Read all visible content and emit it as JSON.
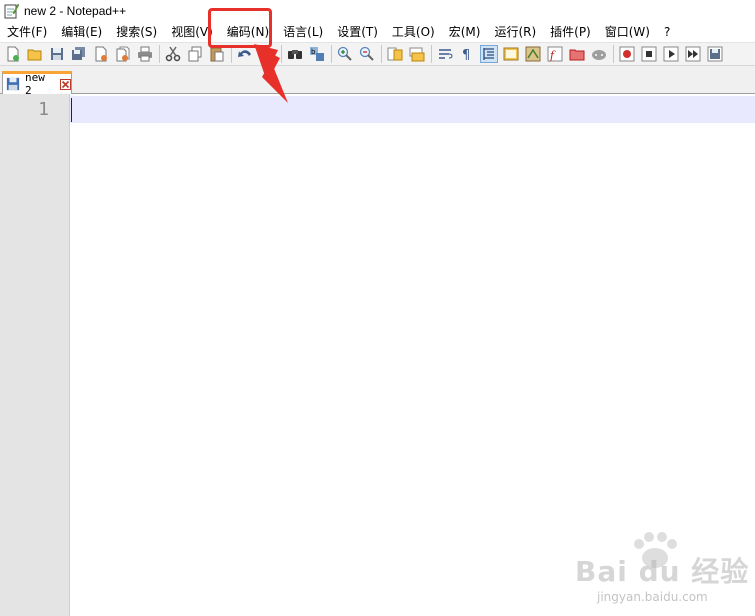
{
  "window": {
    "title": "new 2 - Notepad++"
  },
  "menu": [
    "文件(F)",
    "编辑(E)",
    "搜索(S)",
    "视图(V)",
    "编码(N)",
    "语言(L)",
    "设置(T)",
    "工具(O)",
    "宏(M)",
    "运行(R)",
    "插件(P)",
    "窗口(W)",
    "?"
  ],
  "tabs": [
    {
      "label": "new 2"
    }
  ],
  "editor": {
    "line_numbers": [
      "1"
    ]
  },
  "watermark": {
    "text": "Bai du 经验",
    "sub": "jingyan.baidu.com"
  },
  "colors": {
    "annotation": "#e8302a",
    "active_tab_accent": "#f9a435",
    "current_line": "#e8e8ff"
  }
}
